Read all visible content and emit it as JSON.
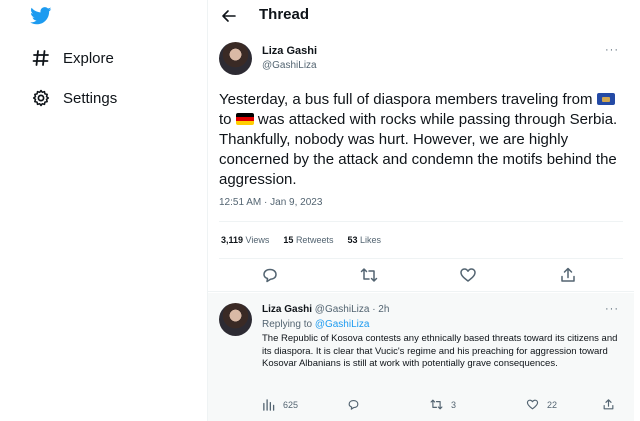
{
  "colors": {
    "brand": "#1d9bf0",
    "text": "#0f1419",
    "muted": "#536471"
  },
  "sidebar": {
    "logo_icon": "twitter-bird-icon",
    "items": [
      {
        "icon": "hashtag-icon",
        "label": "Explore"
      },
      {
        "icon": "gear-icon",
        "label": "Settings"
      }
    ]
  },
  "header": {
    "title": "Thread",
    "back_icon": "arrow-left-icon"
  },
  "tweet": {
    "author_name": "Liza Gashi",
    "author_handle": "@GashiLiza",
    "more": "···",
    "text_part1": "Yesterday, a bus full of diaspora members traveling from ",
    "text_flag1": "kosovo-flag",
    "text_part2": " to ",
    "text_flag2": "germany-flag",
    "text_part3": " was attacked with rocks while passing through Serbia. Thankfully, nobody was hurt. However, we are highly concerned by the attack and condemn the motifs behind the aggression.",
    "timestamp": "12:51 AM · Jan 9, 2023",
    "stats": {
      "views_count": "3,119",
      "views_label": "Views",
      "retweets_count": "15",
      "retweets_label": "Retweets",
      "likes_count": "53",
      "likes_label": "Likes"
    },
    "actions": [
      "reply-icon",
      "retweet-icon",
      "like-icon",
      "share-icon"
    ]
  },
  "reply": {
    "author_name": "Liza Gashi",
    "meta": "@GashiLiza · 2h",
    "more": "···",
    "replying_prefix": "Replying to",
    "replying_handle": "@GashiLiza",
    "text": "The Republic of Kosova contests any ethnically based threats toward its citizens and its diaspora. It is clear that Vucic's regime and his preaching for aggression toward Kosovar Albanians is still at work with potentially grave consequences.",
    "views": "625",
    "replies": "",
    "retweets": "3",
    "likes": "22"
  }
}
